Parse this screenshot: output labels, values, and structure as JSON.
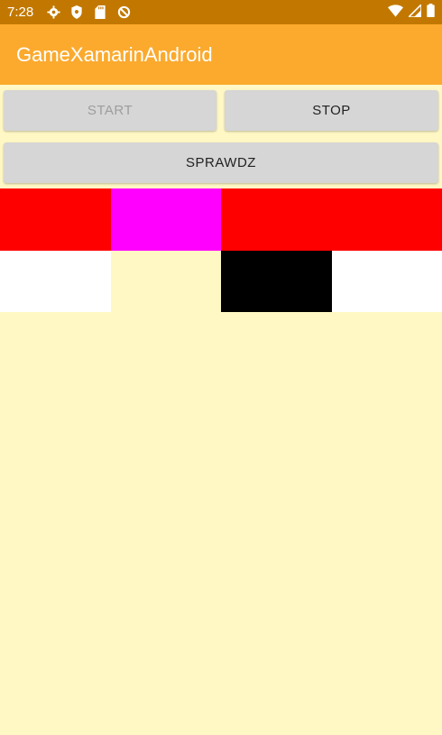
{
  "status_bar": {
    "time": "7:28",
    "icons": [
      "settings-icon",
      "shield-icon",
      "sd-card-icon",
      "sync-blocked-icon"
    ],
    "right_icons": [
      "wifi-icon",
      "signal-icon",
      "battery-icon"
    ]
  },
  "app_bar": {
    "title": "GameXamarinAndroid"
  },
  "buttons": {
    "start": "START",
    "stop": "STOP",
    "check": "SPRAWDZ"
  },
  "grid": {
    "rows": [
      [
        "#ff0000",
        "#ff00ff",
        "#ff0000",
        "#ff0000"
      ],
      [
        "#ffffff",
        "#fff8c5",
        "#000000",
        "#ffffff"
      ]
    ]
  },
  "colors": {
    "status_bar": "#c27800",
    "app_bar": "#fbaa2e",
    "background": "#fff8c5",
    "button": "#d6d6d6"
  }
}
